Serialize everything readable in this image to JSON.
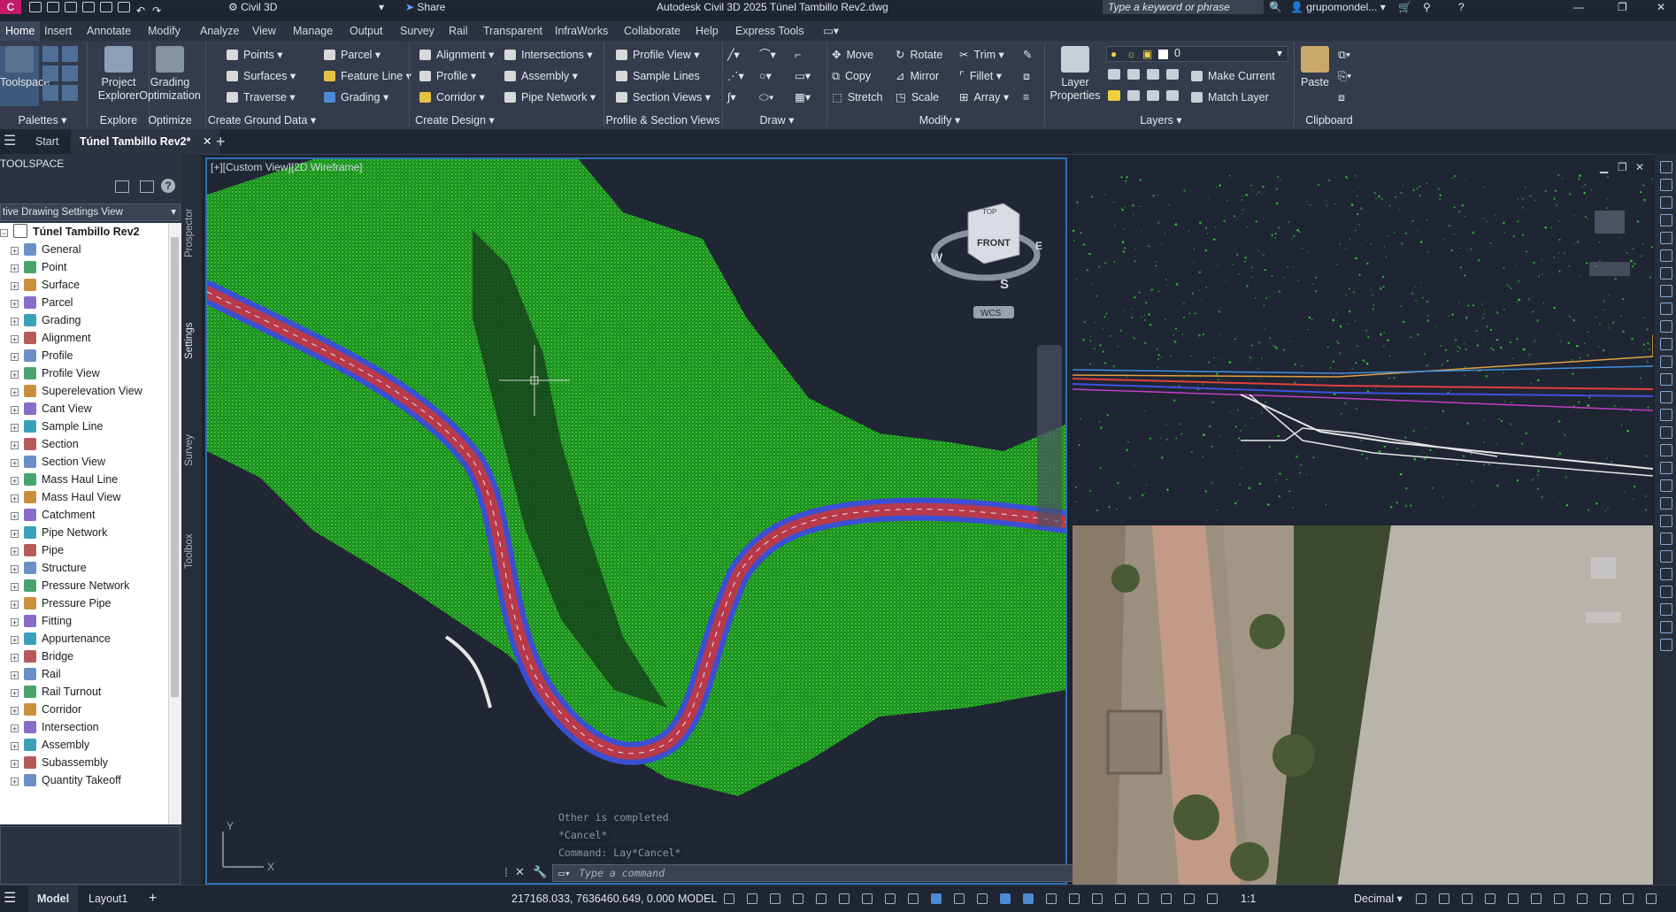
{
  "titlebar": {
    "app_badge": "C",
    "workspace": "Civil 3D",
    "share": "Share",
    "title": "Autodesk Civil 3D 2025  Túnel Tambillo Rev2.dwg",
    "search_placeholder": "Type a keyword or phrase",
    "user": "grupomondel..."
  },
  "menu": [
    "Home",
    "Insert",
    "Annotate",
    "Modify",
    "Analyze",
    "View",
    "Manage",
    "Output",
    "Survey",
    "Rail",
    "Transparent",
    "InfraWorks",
    "Collaborate",
    "Help",
    "Express Tools"
  ],
  "ribbon": {
    "big_buttons": {
      "toolspace": "Toolspace",
      "project_explorer_1": "Project",
      "project_explorer_2": "Explorer",
      "grading_opt_1": "Grading",
      "grading_opt_2": "Optimization",
      "layer_props_1": "Layer",
      "layer_props_2": "Properties",
      "paste": "Paste"
    },
    "create_ground": [
      "Points",
      "Surfaces",
      "Traverse",
      "Parcel",
      "Feature Line",
      "Grading"
    ],
    "create_design": [
      "Alignment",
      "Profile",
      "Corridor",
      "Intersections",
      "Assembly",
      "Pipe Network"
    ],
    "profile_section": [
      "Profile View",
      "Sample Lines",
      "Section Views"
    ],
    "modify": [
      "Move",
      "Copy",
      "Stretch",
      "Rotate",
      "Mirror",
      "Scale",
      "Trim",
      "Fillet",
      "Array"
    ],
    "layers": {
      "current_layer": "0",
      "make_current": "Make Current",
      "match_layer": "Match Layer"
    },
    "panels": [
      "Palettes",
      "Explore",
      "Optimize",
      "Create Ground Data",
      "Create Design",
      "Profile & Section Views",
      "Draw",
      "Modify",
      "Layers",
      "Clipboard"
    ]
  },
  "doctabs": {
    "start": "Start",
    "active": "Túnel Tambillo Rev2*"
  },
  "toolspace": {
    "title": "TOOLSPACE",
    "view_dropdown": "tive Drawing Settings View",
    "root": "Túnel Tambillo Rev2",
    "items": [
      "General",
      "Point",
      "Surface",
      "Parcel",
      "Grading",
      "Alignment",
      "Profile",
      "Profile View",
      "Superelevation View",
      "Cant View",
      "Sample Line",
      "Section",
      "Section View",
      "Mass Haul Line",
      "Mass Haul View",
      "Catchment",
      "Pipe Network",
      "Pipe",
      "Structure",
      "Pressure Network",
      "Pressure Pipe",
      "Fitting",
      "Appurtenance",
      "Bridge",
      "Rail",
      "Rail Turnout",
      "Corridor",
      "Intersection",
      "Assembly",
      "Subassembly",
      "Quantity Takeoff"
    ],
    "side_tabs": [
      "Prospector",
      "Settings",
      "Survey",
      "Toolbox"
    ]
  },
  "viewport": {
    "label": "[+][Custom View][2D Wireframe]",
    "viewcube_top": "TOP",
    "viewcube_front": "FRONT",
    "compass_w": "W",
    "compass_e": "E",
    "compass_s": "S",
    "wcs": "WCS",
    "ucs_y": "Y",
    "ucs_x": "X"
  },
  "command": {
    "history": [
      "Other is completed",
      "*Cancel*",
      "Command: Lay*Cancel*"
    ],
    "placeholder": "Type a command"
  },
  "status": {
    "model_tab": "Model",
    "layout_tab": "Layout1",
    "coords": "217168.033, 7636460.649, 0.000",
    "space": "MODEL",
    "scale": "1:1",
    "units": "Decimal"
  },
  "colors": {
    "terrain": "#2fd12f",
    "road_outer": "#3a4fd4",
    "road_inner": "#b83a4a",
    "viewport_border": "#2e6fb5"
  }
}
